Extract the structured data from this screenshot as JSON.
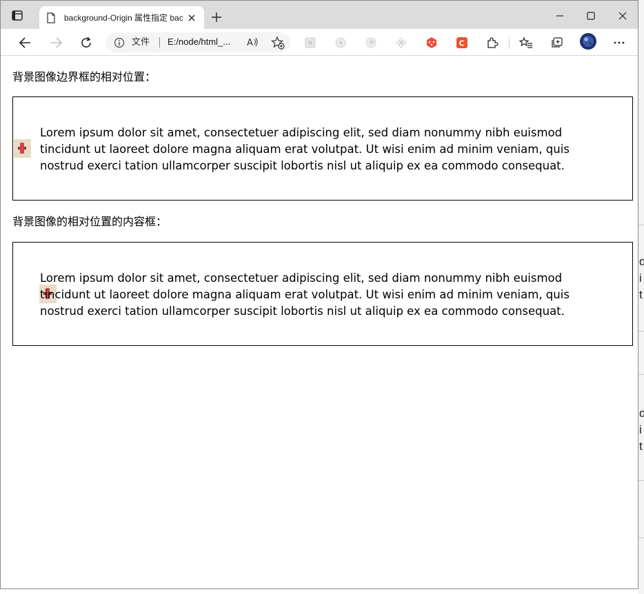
{
  "browser": {
    "tab_title": "background-Origin 属性指定 background-position",
    "site_label": "文件",
    "url": "E:/node/html_..."
  },
  "page": {
    "sections": [
      {
        "heading": "背景图像边界框的相对位置：",
        "paragraph": "Lorem ipsum dolor sit amet, consectetuer adipiscing elit, sed diam nonummy nibh euismod tincidunt ut laoreet dolore magna aliquam erat volutpat. Ut wisi enim ad minim veniam, quis nostrud exerci tation ullamcorper suscipit lobortis nisl ut aliquip ex ea commodo consequat."
      },
      {
        "heading": "背景图像的相对位置的内容框：",
        "paragraph": "Lorem ipsum dolor sit amet, consectetuer adipiscing elit, sed diam nonummy nibh euismod tincidunt ut laoreet dolore magna aliquam erat volutpat. Ut wisi enim ad minim veniam, quis nostrud exerci tation ullamcorper suscipit lobortis nisl ut aliquip ex ea commodo consequat."
      }
    ]
  },
  "background_window": {
    "fragments": [
      "d",
      "i",
      "t",
      "d",
      "i",
      "t"
    ]
  },
  "colors": {
    "tabstrip": "#dcdcdc",
    "ext_red": "#e8513a",
    "ext_orange": "#f0532d"
  },
  "icons": {
    "tab_actions": "tab-actions-icon",
    "page": "page-icon",
    "close_tab": "close-icon",
    "new_tab": "plus-icon",
    "minimize": "minimize-icon",
    "maximize": "maximize-icon",
    "close_window": "close-icon",
    "back": "back-arrow-icon",
    "forward": "forward-arrow-icon",
    "refresh": "refresh-icon",
    "info": "info-icon",
    "read_aloud": "read-aloud-icon",
    "add_favorite": "add-favorite-icon",
    "extensions": "puzzle-icon",
    "favorites": "favorites-icon",
    "collections": "collections-icon",
    "profile": "avatar",
    "more": "more-icon"
  }
}
